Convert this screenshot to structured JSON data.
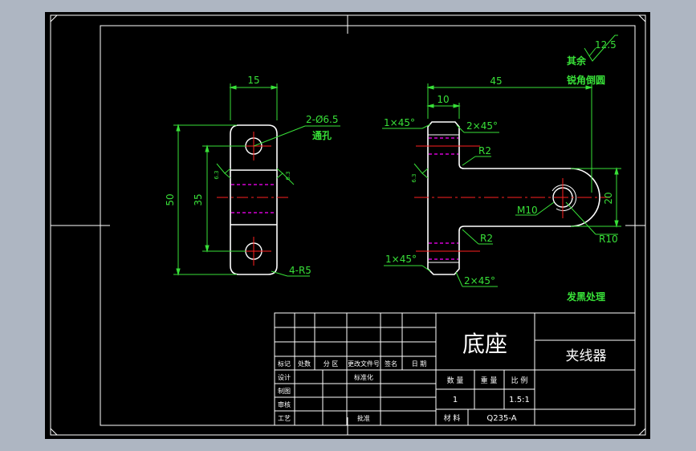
{
  "colors": {
    "background": "#aeb6c2",
    "sheet": "#000000",
    "outline": "#ffffff",
    "dimension": "#38e038",
    "center_line": "#ff2020",
    "hidden_line": "#ff00ff",
    "title_text": "#ffffff"
  },
  "left_view": {
    "dim_width": "15",
    "dim_height_total": "50",
    "dim_height_inner": "35",
    "hole_callout": "2-Ø6.5",
    "hole_note": "通孔",
    "fillet_callout": "4-R5",
    "roughness_left": "6.3",
    "roughness_right": "6.3"
  },
  "right_view": {
    "dim_length": "45",
    "dim_step": "10",
    "chamfer_top_left": "1×45°",
    "chamfer_top_right": "2×45°",
    "chamfer_bottom_left": "1×45°",
    "chamfer_bottom_right": "2×45°",
    "radius_top": "R2",
    "radius_bottom": "R2",
    "thread": "M10",
    "dim_eye_height": "20",
    "radius_eye": "R10",
    "roughness": "6.3"
  },
  "notes": {
    "roughness_value": "12.5",
    "remaining": "其余",
    "deburr": "锐角倒圆",
    "treatment": "发黑处理"
  },
  "title_block": {
    "part_name": "底座",
    "assembly_name": "夹线器",
    "rev_headers": [
      "标记",
      "处数",
      "分 区",
      "更改文件号",
      "签名",
      "日 期"
    ],
    "design": "设计",
    "standardize": "标准化",
    "draw": "制图",
    "review": "审核",
    "process": "工艺",
    "approve": "批准",
    "qty_label": "数 量",
    "weight_label": "重 量",
    "scale_label": "比 例",
    "qty": "1",
    "scale": "1.5:1",
    "material_label": "材 料",
    "material": "Q235-A"
  }
}
